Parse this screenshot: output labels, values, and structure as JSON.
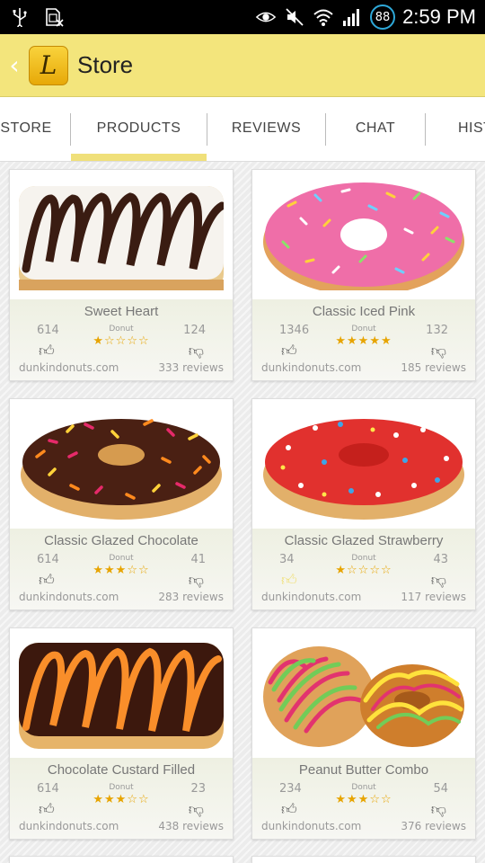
{
  "status_bar": {
    "time": "2:59 PM",
    "battery_level": "88",
    "icons": [
      "usb-icon",
      "sim-blocked-icon",
      "eye-icon",
      "mute-icon",
      "wifi-icon",
      "signal-icon"
    ]
  },
  "app_bar": {
    "title": "Store",
    "logo_letter": "L",
    "back": "‹"
  },
  "tabs": [
    {
      "label": "STORE",
      "selected": false
    },
    {
      "label": "PRODUCTS",
      "selected": true
    },
    {
      "label": "REVIEWS",
      "selected": false
    },
    {
      "label": "CHAT",
      "selected": false
    },
    {
      "label": "HISTO",
      "selected": false
    }
  ],
  "products": [
    {
      "name": "Sweet Heart",
      "category": "Donut",
      "likes": "614",
      "dislikes": "124",
      "rating": 1,
      "source": "dunkindonuts.com",
      "reviews": "333 reviews",
      "liked": false
    },
    {
      "name": "Classic Iced Pink",
      "category": "Donut",
      "likes": "1346",
      "dislikes": "132",
      "rating": 5,
      "source": "dunkindonuts.com",
      "reviews": "185 reviews",
      "liked": false
    },
    {
      "name": "Classic Glazed Chocolate",
      "category": "Donut",
      "likes": "614",
      "dislikes": "41",
      "rating": 3,
      "source": "dunkindonuts.com",
      "reviews": "283 reviews",
      "liked": false
    },
    {
      "name": "Classic Glazed Strawberry",
      "category": "Donut",
      "likes": "34",
      "dislikes": "43",
      "rating": 1,
      "source": "dunkindonuts.com",
      "reviews": "117 reviews",
      "liked": true
    },
    {
      "name": "Chocolate Custard Filled",
      "category": "Donut",
      "likes": "614",
      "dislikes": "23",
      "rating": 3,
      "source": "dunkindonuts.com",
      "reviews": "438 reviews",
      "liked": false
    },
    {
      "name": "Peanut Butter Combo",
      "category": "Donut",
      "likes": "234",
      "dislikes": "54",
      "rating": 3,
      "source": "dunkindonuts.com",
      "reviews": "376 reviews",
      "liked": false
    }
  ],
  "colors": {
    "accent": "#f3e57c",
    "star": "#e7a400",
    "liked_thumb": "#f0e07a"
  }
}
